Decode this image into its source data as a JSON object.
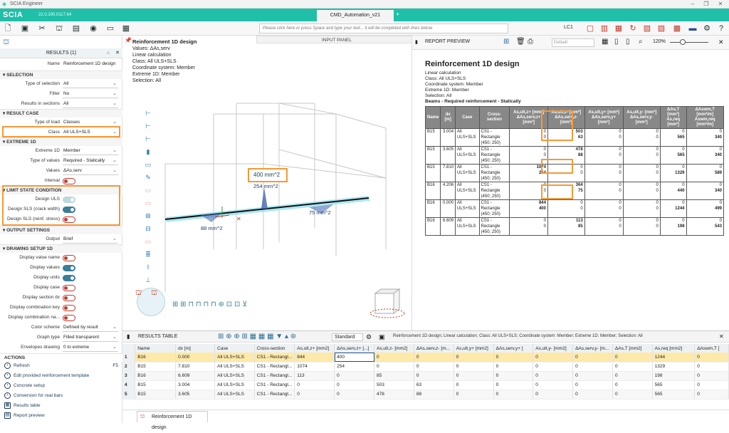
{
  "app": {
    "title": "SCIA Engineer",
    "logo": "SCIA",
    "version": "22.0.100.0117.64",
    "doc_tab": "CMD_Automation_v21",
    "command_placeholder": "Please click here or press Space and type your text... it will be completed with lines below.",
    "lc_label": "LC1"
  },
  "left": {
    "header": "RESULTS (1)",
    "name_label": "Name",
    "name_value": "Reinforcement 1D design",
    "sections": {
      "selection": "SELECTION",
      "result_case": "RESULT CASE",
      "extreme": "EXTREME 1D",
      "limit": "LIMIT STATE CONDITION",
      "output": "OUTPUT SETTINGS",
      "drawing": "DRAWING SETUP 1D",
      "actions": "ACTIONS"
    },
    "rows": {
      "type_sel": {
        "label": "Type of selection",
        "value": "All"
      },
      "filter": {
        "label": "Filter",
        "value": "No"
      },
      "results_in": {
        "label": "Results in sections",
        "value": "All"
      },
      "type_load": {
        "label": "Type of load",
        "value": "Classes"
      },
      "class": {
        "label": "Class",
        "value": "All ULS+SLS"
      },
      "extreme": {
        "label": "Extreme 1D",
        "value": "Member"
      },
      "type_values": {
        "label": "Type of values",
        "value": "Required - Statically"
      },
      "values": {
        "label": "Values",
        "value": "ΔAs,serv"
      },
      "interval": {
        "label": "Interval"
      },
      "design_uls": {
        "label": "Design ULS"
      },
      "design_sls_crack": {
        "label": "Design SLS (crack width)"
      },
      "design_sls_stress": {
        "label": "Design SLS (reinf. stress)"
      },
      "output": {
        "label": "Output",
        "value": "Brief"
      },
      "disp_name": {
        "label": "Display value name"
      },
      "disp_values": {
        "label": "Display values"
      },
      "disp_units": {
        "label": "Display units"
      },
      "disp_case": {
        "label": "Display case"
      },
      "disp_section": {
        "label": "Display section dx"
      },
      "disp_combkey": {
        "label": "Display combination key"
      },
      "disp_combna": {
        "label": "Display combination na..."
      },
      "color_scheme": {
        "label": "Color scheme",
        "value": "Defined by result"
      },
      "graph_type": {
        "label": "Graph type",
        "value": "Filled transparent"
      },
      "envelopes": {
        "label": "Envelopes drawing",
        "value": "0 to extreme"
      }
    },
    "actions": [
      {
        "label": "Refresh",
        "key": "F5"
      },
      {
        "label": "Edit provided reinforcement template"
      },
      {
        "label": "Concrete setup"
      },
      {
        "label": "Conversion for real bars"
      },
      {
        "label": "Results table"
      },
      {
        "label": "Report preview"
      }
    ]
  },
  "viewport": {
    "input_panel": "INPUT PANEL",
    "info_title": "Reinforcement 1D design",
    "info_lines": [
      "Values: ΔAs,serv",
      "Linear calculation",
      "Class: All ULS+SLS",
      "Coordinate system: Member",
      "Extreme 1D: Member",
      "Selection: All"
    ],
    "labels": {
      "l400": "400 mm^2",
      "l254": "254 mm^2",
      "l88": "88 mm^2",
      "l75": "75 mm^2"
    }
  },
  "report": {
    "title": "REPORT PREVIEW",
    "default_placeholder": "Default",
    "zoom": "120%",
    "heading": "Reinforcement  1D design",
    "lines": [
      "Linear  calculation",
      "Class:  All ULS+SLS",
      "Coordinate  system:  Member",
      "Extreme  1D:  Member",
      "Selection:  All"
    ],
    "subheading": "Beams  -  Required  reinforcement  -  Statically",
    "columns": [
      "Name",
      "dx [m]",
      "Case",
      "Cross-section",
      "As,ult,z+ [mm²] ΔAs,serv,z+ [mm²]",
      "As,ult,z- [mm²] ΔAs,serv,z- [mm²]",
      "As,ult,y+ [mm²] ΔAs,serv,y+ [mm²]",
      "As,ult,y- [mm²] ΔAs,serv,y- [mm²]",
      "ΔAs,T [mm²] As,req [mm²]",
      "ΔAswm,T [mm²/m] Aswm,req [mm²/m]"
    ],
    "rows": [
      {
        "name": "B15",
        "dx": "3.004",
        "case": "All ULS+SLS",
        "cs": "CS1 - Rectangle (450; 250)",
        "a": [
          "0",
          "0"
        ],
        "b": [
          "503",
          "63"
        ],
        "c": [
          "0",
          "0"
        ],
        "d": [
          "0",
          "0"
        ],
        "e": [
          "0",
          "565"
        ],
        "f": [
          "0",
          "340"
        ]
      },
      {
        "name": "B15",
        "dx": "3.605",
        "case": "All ULS+SLS",
        "cs": "CS1 - Rectangle (450; 250)",
        "a": [
          "0",
          "0"
        ],
        "b": [
          "478",
          "88"
        ],
        "c": [
          "0",
          "0"
        ],
        "d": [
          "0",
          "0"
        ],
        "e": [
          "0",
          "565"
        ],
        "f": [
          "0",
          "340"
        ]
      },
      {
        "name": "B15",
        "dx": "7.810",
        "case": "All ULS+SLS",
        "cs": "CS1 - Rectangle (450; 250)",
        "a": [
          "1074",
          "254"
        ],
        "b": [
          "0",
          "0"
        ],
        "c": [
          "0",
          "0"
        ],
        "d": [
          "0",
          "0"
        ],
        "e": [
          "0",
          "1329"
        ],
        "f": [
          "0",
          "589"
        ]
      },
      {
        "name": "B16",
        "dx": "4.206",
        "case": "All ULS+SLS",
        "cs": "CS1 - Rectangle (450; 250)",
        "a": [
          "0",
          "0"
        ],
        "b": [
          "364",
          "75"
        ],
        "c": [
          "0",
          "0"
        ],
        "d": [
          "0",
          "0"
        ],
        "e": [
          "0",
          "440"
        ],
        "f": [
          "0",
          "340"
        ]
      },
      {
        "name": "B16",
        "dx": "0.000",
        "case": "All ULS+SLS",
        "cs": "CS1 - Rectangle (450; 250)",
        "a": [
          "844",
          "400"
        ],
        "b": [
          "0",
          "0"
        ],
        "c": [
          "0",
          "0"
        ],
        "d": [
          "0",
          "0"
        ],
        "e": [
          "0",
          "1244"
        ],
        "f": [
          "0",
          "499"
        ]
      },
      {
        "name": "B16",
        "dx": "6.609",
        "case": "All ULS+SLS",
        "cs": "CS1 - Rectangle (450; 250)",
        "a": [
          "0",
          "0"
        ],
        "b": [
          "113",
          "85"
        ],
        "c": [
          "0",
          "0"
        ],
        "d": [
          "0",
          "0"
        ],
        "e": [
          "0",
          "198"
        ],
        "f": [
          "0",
          "543"
        ]
      }
    ]
  },
  "bottom": {
    "title": "RESULTS TABLE",
    "standard": "Standard",
    "description": "Reinforcement 1D design; Linear calculation; Class: All ULS+SLS; Coordinate system: Member; Extreme 1D: Member; Selection: All",
    "columns": [
      "",
      "Name",
      "dx [m]",
      "Case",
      "Cross-section",
      "As,ult,z+ [mm2]",
      "ΔAs,serv,z+ [...]",
      "As,ult,z- [mm2]",
      "ΔAs,serv,z- [m...",
      "As,ult,y+ [mm2]",
      "ΔAs,serv,y+ [",
      "As,ult,y- [mm2]",
      "ΔAs,serv,y- [m...",
      "ΔAs,T [mm2]",
      "As,req [mm2]",
      "ΔAswm,T ["
    ],
    "rows": [
      [
        "1",
        "B16",
        "0.000",
        "All ULS+SLS",
        "CS1 - Rectangl...",
        "844",
        "400",
        "0",
        "0",
        "0",
        "0",
        "0",
        "0",
        "0",
        "1244",
        "0"
      ],
      [
        "2",
        "B15",
        "7.810",
        "All ULS+SLS",
        "CS1 - Rectangl...",
        "1074",
        "254",
        "0",
        "0",
        "0",
        "0",
        "0",
        "0",
        "0",
        "1329",
        "0"
      ],
      [
        "3",
        "B16",
        "6.609",
        "All ULS+SLS",
        "CS1 - Rectangl...",
        "113",
        "0",
        "85",
        "0",
        "0",
        "0",
        "0",
        "0",
        "0",
        "198",
        "0"
      ],
      [
        "4",
        "B15",
        "3.004",
        "All ULS+SLS",
        "CS1 - Rectangl...",
        "0",
        "0",
        "503",
        "63",
        "0",
        "0",
        "0",
        "0",
        "0",
        "565",
        "0"
      ],
      [
        "5",
        "B15",
        "3.605",
        "All ULS+SLS",
        "CS1 - Rectangl...",
        "0",
        "0",
        "478",
        "88",
        "0",
        "0",
        "0",
        "0",
        "0",
        "565",
        "0"
      ]
    ],
    "tab": "Reinforcement 1D design"
  }
}
